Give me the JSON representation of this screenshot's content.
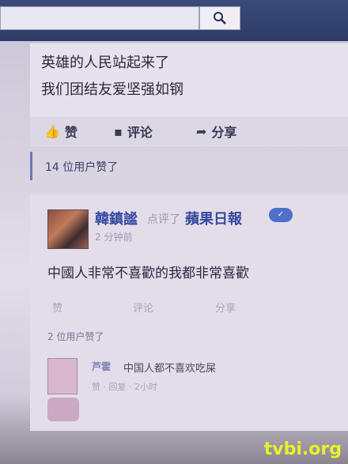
{
  "search": {
    "value": ""
  },
  "post1": {
    "line1": "英雄的人民站起来了",
    "line2": "我们团结友爱坚强如钢"
  },
  "actions": {
    "like": "赞",
    "comment": "评论",
    "share": "分享"
  },
  "post1_likes": "14 位用户赞了",
  "post2": {
    "author": "韓鎮謐",
    "shared_text": "点评了",
    "page": "蘋果日報",
    "badge": "",
    "time": "2 分钟前",
    "text": "中國人非常不喜歡的我都非常喜歡",
    "actions": {
      "like": "赞",
      "comment": "评论",
      "share": "分享"
    },
    "likes": "2 位用户赞了",
    "comment": {
      "name": "芦霍",
      "text": "中国人都不喜欢吃屎",
      "actions": "赞 · 回复 · 2小时"
    }
  },
  "watermark": "tvbi.org"
}
